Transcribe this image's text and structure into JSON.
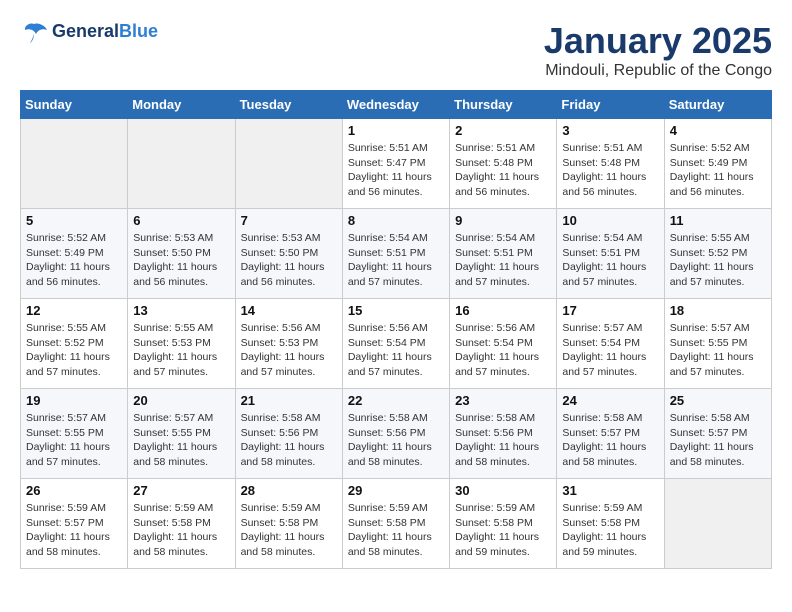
{
  "header": {
    "logo_line1": "General",
    "logo_line2": "Blue",
    "month_title": "January 2025",
    "subtitle": "Mindouli, Republic of the Congo"
  },
  "days_of_week": [
    "Sunday",
    "Monday",
    "Tuesday",
    "Wednesday",
    "Thursday",
    "Friday",
    "Saturday"
  ],
  "weeks": [
    [
      {
        "day": "",
        "info": ""
      },
      {
        "day": "",
        "info": ""
      },
      {
        "day": "",
        "info": ""
      },
      {
        "day": "1",
        "info": "Sunrise: 5:51 AM\nSunset: 5:47 PM\nDaylight: 11 hours and 56 minutes."
      },
      {
        "day": "2",
        "info": "Sunrise: 5:51 AM\nSunset: 5:48 PM\nDaylight: 11 hours and 56 minutes."
      },
      {
        "day": "3",
        "info": "Sunrise: 5:51 AM\nSunset: 5:48 PM\nDaylight: 11 hours and 56 minutes."
      },
      {
        "day": "4",
        "info": "Sunrise: 5:52 AM\nSunset: 5:49 PM\nDaylight: 11 hours and 56 minutes."
      }
    ],
    [
      {
        "day": "5",
        "info": "Sunrise: 5:52 AM\nSunset: 5:49 PM\nDaylight: 11 hours and 56 minutes."
      },
      {
        "day": "6",
        "info": "Sunrise: 5:53 AM\nSunset: 5:50 PM\nDaylight: 11 hours and 56 minutes."
      },
      {
        "day": "7",
        "info": "Sunrise: 5:53 AM\nSunset: 5:50 PM\nDaylight: 11 hours and 56 minutes."
      },
      {
        "day": "8",
        "info": "Sunrise: 5:54 AM\nSunset: 5:51 PM\nDaylight: 11 hours and 57 minutes."
      },
      {
        "day": "9",
        "info": "Sunrise: 5:54 AM\nSunset: 5:51 PM\nDaylight: 11 hours and 57 minutes."
      },
      {
        "day": "10",
        "info": "Sunrise: 5:54 AM\nSunset: 5:51 PM\nDaylight: 11 hours and 57 minutes."
      },
      {
        "day": "11",
        "info": "Sunrise: 5:55 AM\nSunset: 5:52 PM\nDaylight: 11 hours and 57 minutes."
      }
    ],
    [
      {
        "day": "12",
        "info": "Sunrise: 5:55 AM\nSunset: 5:52 PM\nDaylight: 11 hours and 57 minutes."
      },
      {
        "day": "13",
        "info": "Sunrise: 5:55 AM\nSunset: 5:53 PM\nDaylight: 11 hours and 57 minutes."
      },
      {
        "day": "14",
        "info": "Sunrise: 5:56 AM\nSunset: 5:53 PM\nDaylight: 11 hours and 57 minutes."
      },
      {
        "day": "15",
        "info": "Sunrise: 5:56 AM\nSunset: 5:54 PM\nDaylight: 11 hours and 57 minutes."
      },
      {
        "day": "16",
        "info": "Sunrise: 5:56 AM\nSunset: 5:54 PM\nDaylight: 11 hours and 57 minutes."
      },
      {
        "day": "17",
        "info": "Sunrise: 5:57 AM\nSunset: 5:54 PM\nDaylight: 11 hours and 57 minutes."
      },
      {
        "day": "18",
        "info": "Sunrise: 5:57 AM\nSunset: 5:55 PM\nDaylight: 11 hours and 57 minutes."
      }
    ],
    [
      {
        "day": "19",
        "info": "Sunrise: 5:57 AM\nSunset: 5:55 PM\nDaylight: 11 hours and 57 minutes."
      },
      {
        "day": "20",
        "info": "Sunrise: 5:57 AM\nSunset: 5:55 PM\nDaylight: 11 hours and 58 minutes."
      },
      {
        "day": "21",
        "info": "Sunrise: 5:58 AM\nSunset: 5:56 PM\nDaylight: 11 hours and 58 minutes."
      },
      {
        "day": "22",
        "info": "Sunrise: 5:58 AM\nSunset: 5:56 PM\nDaylight: 11 hours and 58 minutes."
      },
      {
        "day": "23",
        "info": "Sunrise: 5:58 AM\nSunset: 5:56 PM\nDaylight: 11 hours and 58 minutes."
      },
      {
        "day": "24",
        "info": "Sunrise: 5:58 AM\nSunset: 5:57 PM\nDaylight: 11 hours and 58 minutes."
      },
      {
        "day": "25",
        "info": "Sunrise: 5:58 AM\nSunset: 5:57 PM\nDaylight: 11 hours and 58 minutes."
      }
    ],
    [
      {
        "day": "26",
        "info": "Sunrise: 5:59 AM\nSunset: 5:57 PM\nDaylight: 11 hours and 58 minutes."
      },
      {
        "day": "27",
        "info": "Sunrise: 5:59 AM\nSunset: 5:58 PM\nDaylight: 11 hours and 58 minutes."
      },
      {
        "day": "28",
        "info": "Sunrise: 5:59 AM\nSunset: 5:58 PM\nDaylight: 11 hours and 58 minutes."
      },
      {
        "day": "29",
        "info": "Sunrise: 5:59 AM\nSunset: 5:58 PM\nDaylight: 11 hours and 58 minutes."
      },
      {
        "day": "30",
        "info": "Sunrise: 5:59 AM\nSunset: 5:58 PM\nDaylight: 11 hours and 59 minutes."
      },
      {
        "day": "31",
        "info": "Sunrise: 5:59 AM\nSunset: 5:58 PM\nDaylight: 11 hours and 59 minutes."
      },
      {
        "day": "",
        "info": ""
      }
    ]
  ]
}
